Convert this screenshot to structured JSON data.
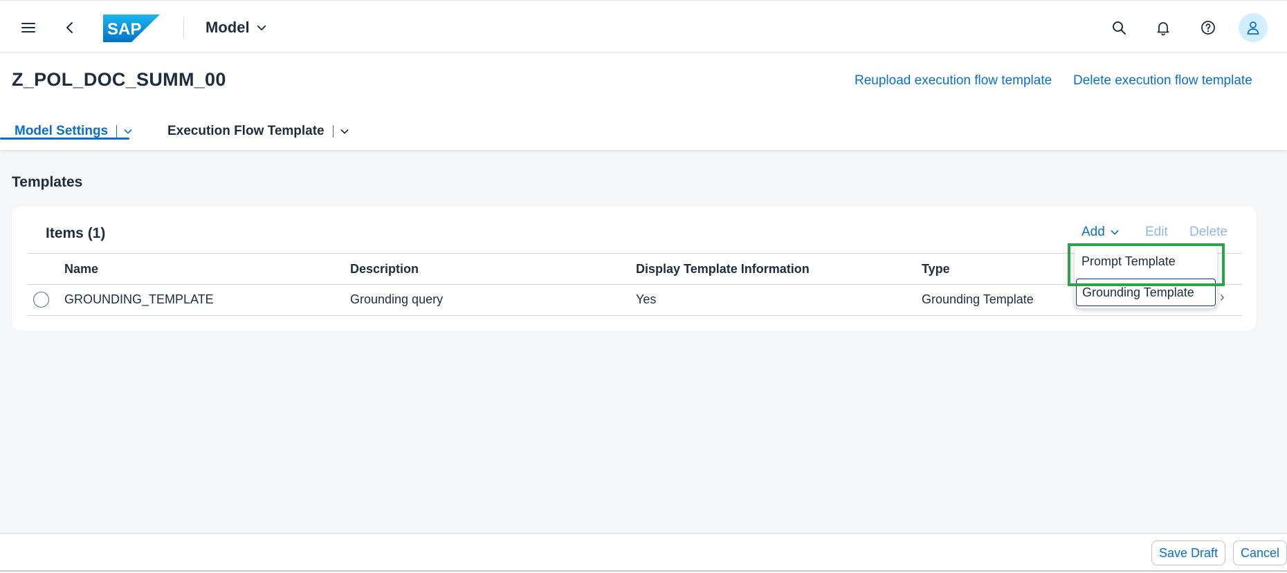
{
  "shell": {
    "brand": "SAP",
    "product_title": "Model",
    "icons": [
      "menu-icon",
      "back-icon",
      "search-icon",
      "bell-icon",
      "help-icon",
      "user-icon"
    ]
  },
  "header": {
    "title": "Z_POL_DOC_SUMM_00",
    "actions": {
      "reupload": "Reupload execution flow template",
      "delete": "Delete execution flow template"
    },
    "tabs": [
      {
        "label": "Model Settings",
        "selected": true
      },
      {
        "label": "Execution Flow Template",
        "selected": false
      }
    ]
  },
  "section": {
    "title": "Templates"
  },
  "table": {
    "title": "Items (1)",
    "toolbar": {
      "add": "Add",
      "edit": "Edit",
      "delete": "Delete"
    },
    "columns": [
      "Name",
      "Description",
      "Display Template Information",
      "Type"
    ],
    "rows": [
      {
        "name": "GROUNDING_TEMPLATE",
        "description": "Grounding query",
        "display_info": "Yes",
        "type": "Grounding Template"
      }
    ]
  },
  "add_menu": {
    "items": [
      "Prompt Template",
      "Grounding Template"
    ],
    "focused": "Grounding Template"
  },
  "footer": {
    "save_draft": "Save Draft",
    "cancel": "Cancel"
  },
  "colors": {
    "accent": "#0a6ed1",
    "disabled": "#8fb8e6",
    "highlight": "#27a644",
    "background": "#f5f6f7"
  }
}
